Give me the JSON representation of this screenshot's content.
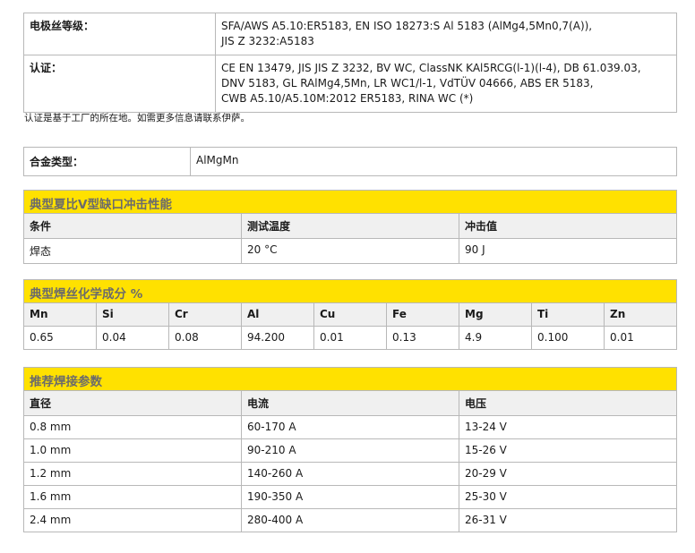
{
  "spec": {
    "classification_label": "电极丝等级：",
    "classification_lines": [
      "SFA/AWS A5.10:ER5183, EN ISO 18273:S Al 5183  (AlMg4,5Mn0,7(A)),",
      "JIS Z 3232:A5183"
    ],
    "approvals_label": "认证：",
    "approvals_lines": [
      "CE EN 13479, JIS JIS Z 3232, BV WC, ClassNK KAl5RCG(l-1)(l-4), DB 61.039.03,",
      "DNV 5183, GL RAlMg4,5Mn, LR WC1/l-1, VdTÜV 04666, ABS ER 5183,",
      "CWB A5.10/A5.10M:2012 ER5183, RINA WC (*)"
    ]
  },
  "note": "认证是基于工厂的所在地。如需更多信息请联系伊萨。",
  "alloy": {
    "label": "合金类型：",
    "value": "AlMgMn"
  },
  "impact": {
    "title": "典型夏比V型缺口冲击性能",
    "headers": [
      "条件",
      "测试温度",
      "冲击值"
    ],
    "rows": [
      [
        "焊态",
        "20 °C",
        "90 J"
      ]
    ]
  },
  "chem": {
    "title": "典型焊丝化学成分 %",
    "headers": [
      "Mn",
      "Si",
      "Cr",
      "Al",
      "Cu",
      "Fe",
      "Mg",
      "Ti",
      "Zn"
    ],
    "values": [
      "0.65",
      "0.04",
      "0.08",
      "94.200",
      "0.01",
      "0.13",
      "4.9",
      "0.100",
      "0.01"
    ]
  },
  "weld": {
    "title": "推荐焊接参数",
    "headers": [
      "直径",
      "电流",
      "电压"
    ],
    "rows": [
      [
        "0.8 mm",
        "60-170 A",
        "13-24 V"
      ],
      [
        "1.0 mm",
        "90-210 A",
        "15-26 V"
      ],
      [
        "1.2 mm",
        "140-260 A",
        "20-29 V"
      ],
      [
        "1.6 mm",
        "190-350 A",
        "25-30 V"
      ],
      [
        "2.4 mm",
        "280-400 A",
        "26-31 V"
      ]
    ]
  },
  "colors": {
    "header_bar": "#ffe100",
    "header_text": "#6b6b6b",
    "border": "#b8b8b8",
    "column_header_bg": "#f0f0f0"
  }
}
